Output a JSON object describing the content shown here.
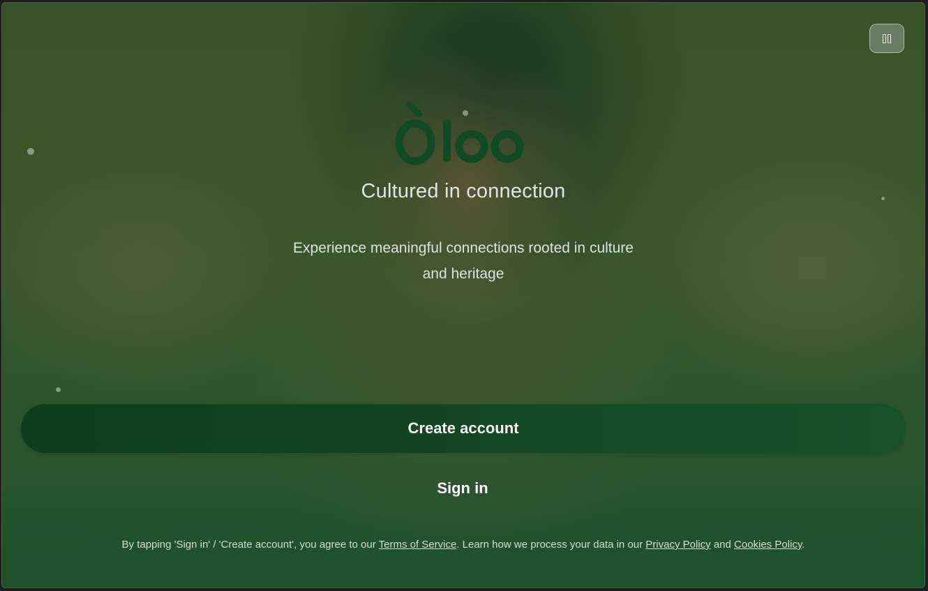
{
  "app": {
    "brand": "Òloo",
    "tagline": "Cultured in connection",
    "description": "Experience meaningful connections rooted in culture and heritage"
  },
  "controls": {
    "pause_icon": "pause-icon"
  },
  "actions": {
    "create_account": "Create account",
    "sign_in": "Sign in"
  },
  "legal": {
    "prefix": "By tapping 'Sign in' / 'Create account', you agree to our ",
    "terms": "Terms of Service",
    "middle": ". Learn how we process your data in our ",
    "privacy": "Privacy Policy",
    "and": " and ",
    "cookies": "Cookies Policy",
    "suffix": "."
  },
  "colors": {
    "brand_green": "#0f4a22",
    "button_green": "#124722",
    "text_light": "#dfe6df"
  }
}
